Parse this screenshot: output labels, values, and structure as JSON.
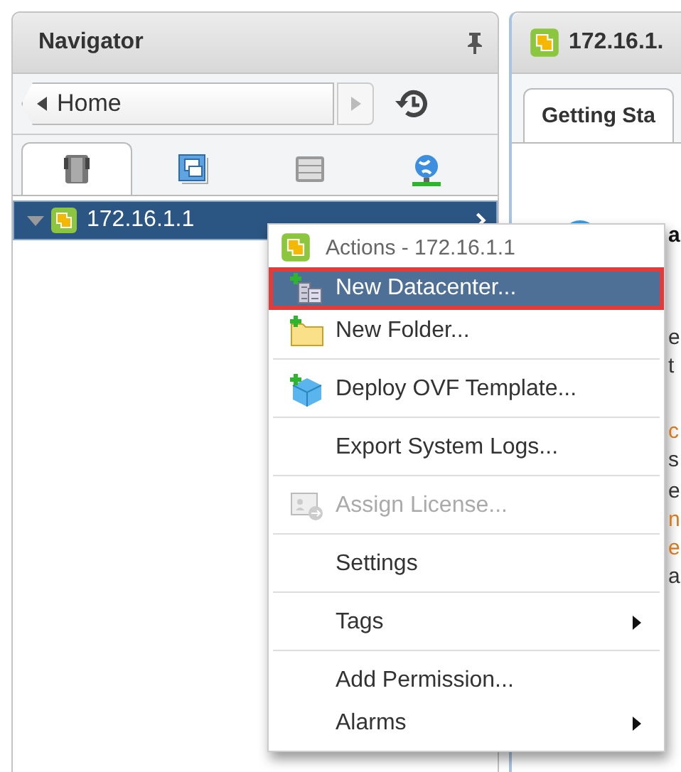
{
  "navigator": {
    "title": "Navigator",
    "history": {
      "label": "Home"
    },
    "icon_tabs": [
      {
        "selected": true
      },
      {
        "selected": false
      },
      {
        "selected": false
      },
      {
        "selected": false
      }
    ],
    "tree": [
      {
        "label": "172.16.1.1",
        "expanded": true,
        "selected": true
      }
    ]
  },
  "object_panel": {
    "title": "172.16.1.",
    "tabs": [
      {
        "label": "Getting Sta",
        "selected": true
      }
    ],
    "fragments": [
      {
        "text": "a",
        "kind": "heading"
      },
      {
        "text": "e",
        "kind": "text"
      },
      {
        "text": "t",
        "kind": "text"
      },
      {
        "text": "c",
        "kind": "link"
      },
      {
        "text": "s",
        "kind": "text"
      },
      {
        "text": "e",
        "kind": "text"
      },
      {
        "text": "n",
        "kind": "link"
      },
      {
        "text": "e",
        "kind": "link"
      },
      {
        "text": "a",
        "kind": "text"
      }
    ]
  },
  "context_menu": {
    "title": "Actions - 172.16.1.1",
    "items": [
      {
        "label": "New Datacenter...",
        "selected": true,
        "disabled": false,
        "submenu": false,
        "separator_before": false
      },
      {
        "label": "New Folder...",
        "selected": false,
        "disabled": false,
        "submenu": false,
        "separator_before": false
      },
      {
        "label": "Deploy OVF Template...",
        "selected": false,
        "disabled": false,
        "submenu": false,
        "separator_before": true
      },
      {
        "label": "Export System Logs...",
        "selected": false,
        "disabled": false,
        "submenu": false,
        "separator_before": true
      },
      {
        "label": "Assign License...",
        "selected": false,
        "disabled": true,
        "submenu": false,
        "separator_before": true
      },
      {
        "label": "Settings",
        "selected": false,
        "disabled": false,
        "submenu": false,
        "separator_before": true
      },
      {
        "label": "Tags",
        "selected": false,
        "disabled": false,
        "submenu": true,
        "separator_before": true
      },
      {
        "label": "Add Permission...",
        "selected": false,
        "disabled": false,
        "submenu": false,
        "separator_before": true
      },
      {
        "label": "Alarms",
        "selected": false,
        "disabled": false,
        "submenu": true,
        "separator_before": false
      }
    ]
  }
}
